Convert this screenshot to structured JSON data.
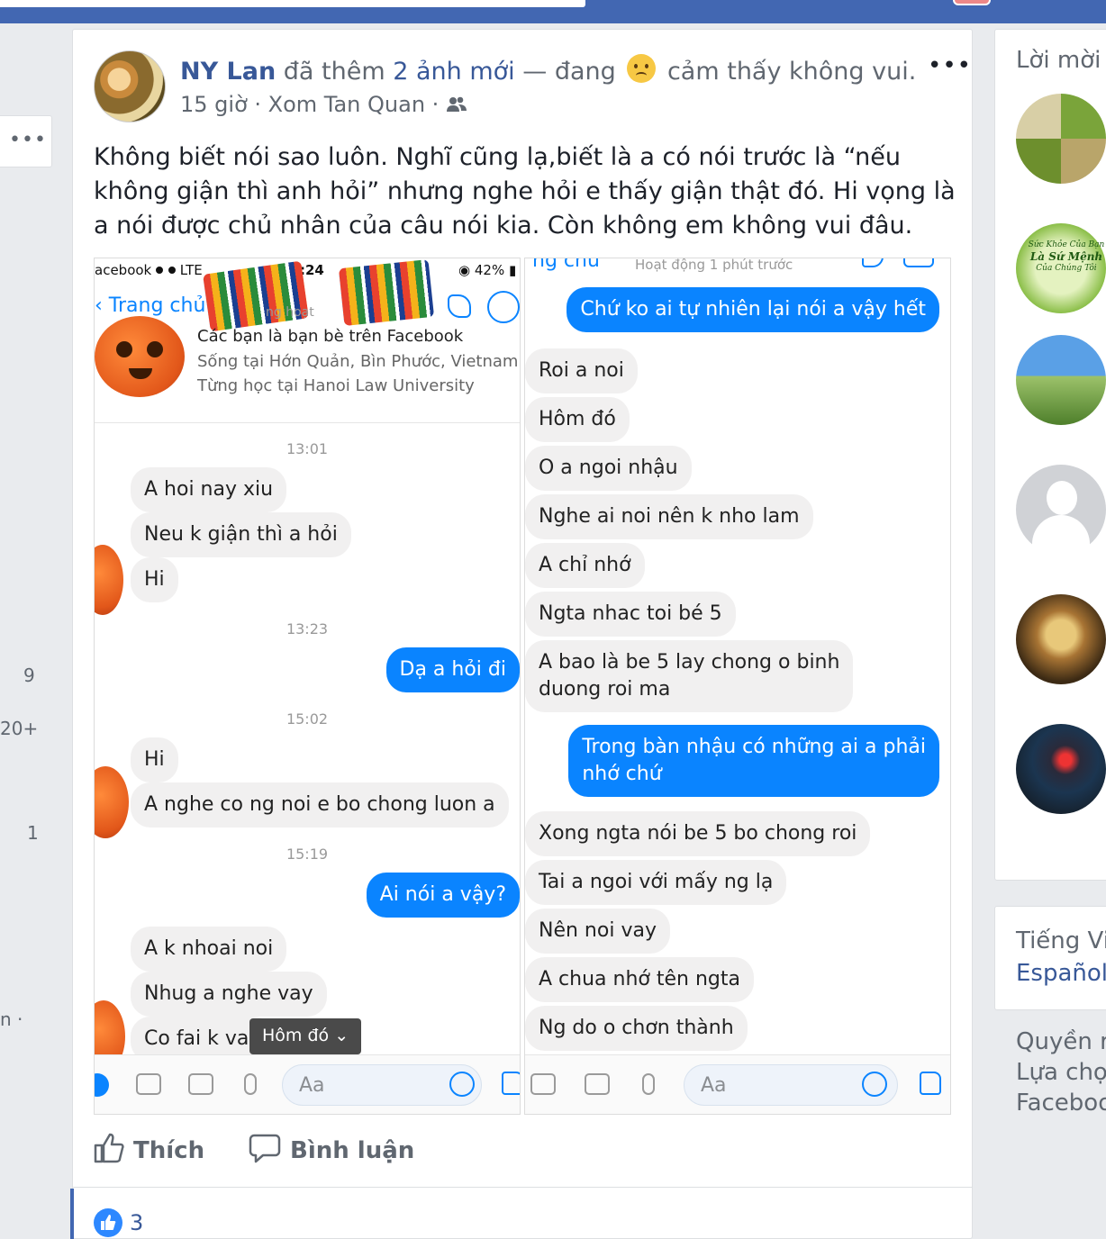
{
  "left_column": {
    "more_label": "•••",
    "counts": [
      "9",
      "20+",
      "1"
    ],
    "fragment": "n ·"
  },
  "post": {
    "author": "NY Lan",
    "action_text": " đã thêm ",
    "photos_link": "2 ảnh mới",
    "feeling_prefix": " — đang ",
    "feeling_text": " cảm thấy không vui.",
    "meta": "15 giờ · Xom Tan Quan · ",
    "body": "Không biết nói sao luôn. Nghĩ cũng lạ,biết là a có nói trước là “nếu không giận thì anh hỏi” nhưng nghe hỏi e thấy giận thật đó. Hi vọng là a nói được chủ nhân của câu nói kia. Còn không em không vui đâu.",
    "more_label": "•••",
    "like_label": "Thích",
    "comment_label": "Bình luận",
    "reaction_count": "3"
  },
  "screenshot1": {
    "status_carrier": "acebook ",
    "status_lte": "LTE",
    "status_time": ":24",
    "status_battery": "42%",
    "back_label": "Trang chủ",
    "status_sub": "ng hoạt",
    "friend_note": "Các bạn là bạn bè trên Facebook",
    "lives_in": "Sống tại Hớn Quản, Bìn Phước, Vietnam",
    "studied": "Từng học tại Hanoi Law University",
    "t1": "13:01",
    "m1": "A hoi nay xiu",
    "m2": "Neu k giận thì a hỏi",
    "m3": "Hi",
    "t2": "13:23",
    "m4": "Dạ a hỏi đi",
    "t3": "15:02",
    "m5": "Hi",
    "m6": "A nghe co ng noi e bo chong luon a",
    "t4": "15:19",
    "m7": "Ai nói a vậy?",
    "m8": "A k nhoai noi",
    "m9": "Nhug a nghe vay",
    "m10": "Co fai k vay",
    "pill": "Hôm đó",
    "composer_placeholder": "Aa"
  },
  "screenshot2": {
    "top_fragment": "ng chủ",
    "active": "Hoạt động 1 phút trước",
    "m1": "Chứ ko ai tự nhiên lại nói a vậy hết",
    "m2": "Roi a noi",
    "m3": "Hôm đó",
    "m4": "O a ngoi nhậu",
    "m5": "Nghe ai noi nên k nho lam",
    "m6": "A chỉ nhớ",
    "m7": "Ngta nhac toi bé 5",
    "m8a": "A bao là be 5 lay chong o binh",
    "m8b": "duong roi ma",
    "m9a": "Trong bàn nhậu có những ai a phải",
    "m9b": "nhớ chứ",
    "m10": "Xong ngta nói be 5 bo chong roi",
    "m11": "Tai a ngoi với mấy ng lạ",
    "m12": "Nên noi vay",
    "m13": "A chua nhớ tên ngta",
    "m14": "Ng do o chơn thành",
    "composer_placeholder": "Aa"
  },
  "right_column": {
    "invites_title": "Lời mời k",
    "page_sticker_line1": "Sức Khỏe Của Bạn",
    "page_sticker_line2": "Là Sứ Mệnh",
    "page_sticker_line3": "Của Chúng Tôi",
    "lang1": "Tiếng Việ",
    "lang2": "Español",
    "footer1": "Quyền ri",
    "footer2": "Lựa chọn",
    "footer3": "Faceboo"
  },
  "colors": {
    "facebook_blue": "#4267b2",
    "link_blue": "#385898",
    "messenger_blue": "#0a84ff"
  }
}
